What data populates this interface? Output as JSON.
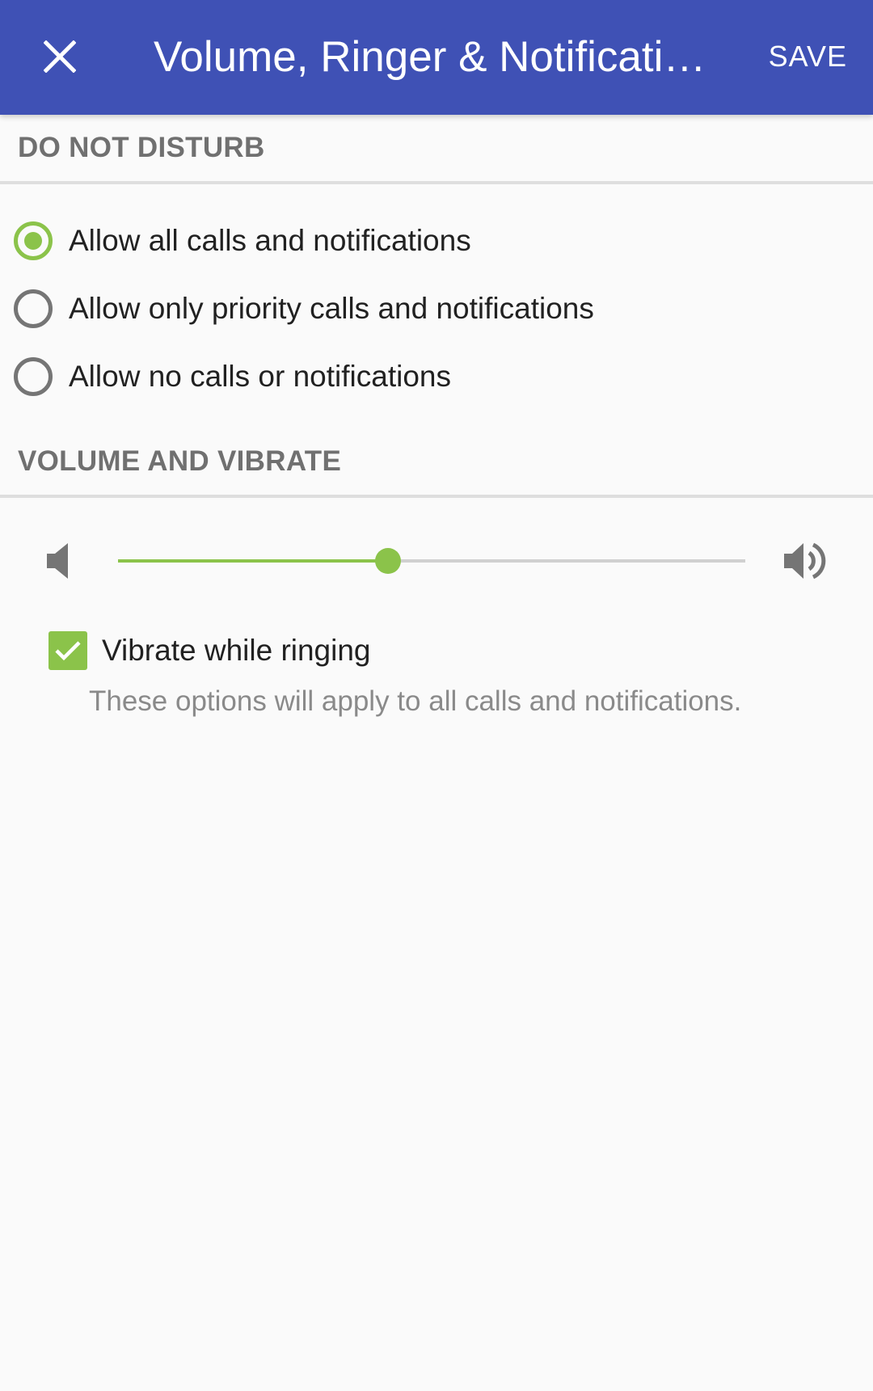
{
  "app_bar": {
    "title": "Volume, Ringer & Notifications",
    "save_label": "SAVE",
    "close_icon": "close-icon",
    "background_color": "#3f51b5"
  },
  "do_not_disturb": {
    "header": "DO NOT DISTURB",
    "options": [
      {
        "label": "Allow all calls and notifications",
        "selected": true
      },
      {
        "label": "Allow only priority calls and notifications",
        "selected": false
      },
      {
        "label": "Allow no calls or notifications",
        "selected": false
      }
    ]
  },
  "volume_and_vibrate": {
    "header": "VOLUME AND VIBRATE",
    "volume_level": 0.43,
    "icons": {
      "low": "volume-low-icon",
      "high": "volume-high-icon"
    },
    "vibrate_label": "Vibrate while ringing",
    "vibrate_checked": true,
    "helper_text": "These options will apply to all calls and notifications."
  },
  "colors": {
    "accent": "#8bc34a",
    "section_header": "#707070",
    "helper_text": "#8a8a8a"
  }
}
